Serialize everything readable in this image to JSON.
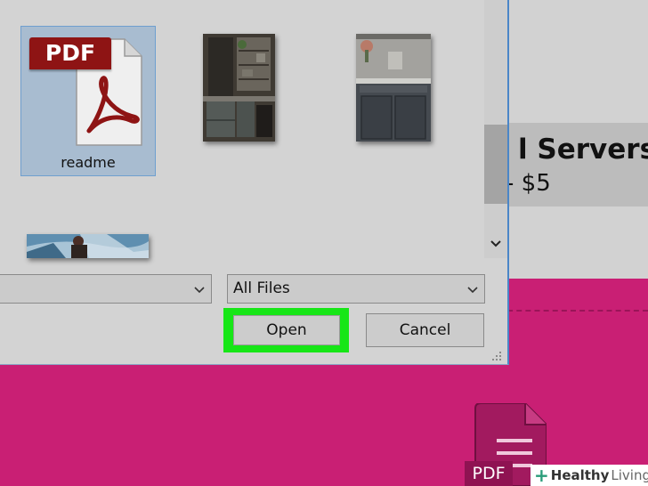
{
  "background_page": {
    "heading_fragment": "l Servers",
    "price_fragment": "- $5",
    "pdf_icon_label": "PDF"
  },
  "watermark": {
    "plus": "+",
    "word1": "Healthy",
    "word2": "Living"
  },
  "dialog": {
    "files": [
      {
        "name": "readme",
        "type": "pdf",
        "badge": "PDF",
        "selected": true
      },
      {
        "name": "",
        "type": "image",
        "icon": "kitchen-shelves-photo"
      },
      {
        "name": "",
        "type": "image",
        "icon": "kitchen-sink-photo"
      },
      {
        "name": "",
        "type": "image",
        "icon": "snowboarder-photo"
      }
    ],
    "filename_input": {
      "value": ""
    },
    "file_type_select": {
      "selected": "All Files"
    },
    "open_button": "Open",
    "cancel_button": "Cancel"
  },
  "colors": {
    "highlight": "#17e617",
    "selection": "#a8bcd0",
    "background_accent": "#c91f74",
    "pdf_red": "#8e1414"
  }
}
